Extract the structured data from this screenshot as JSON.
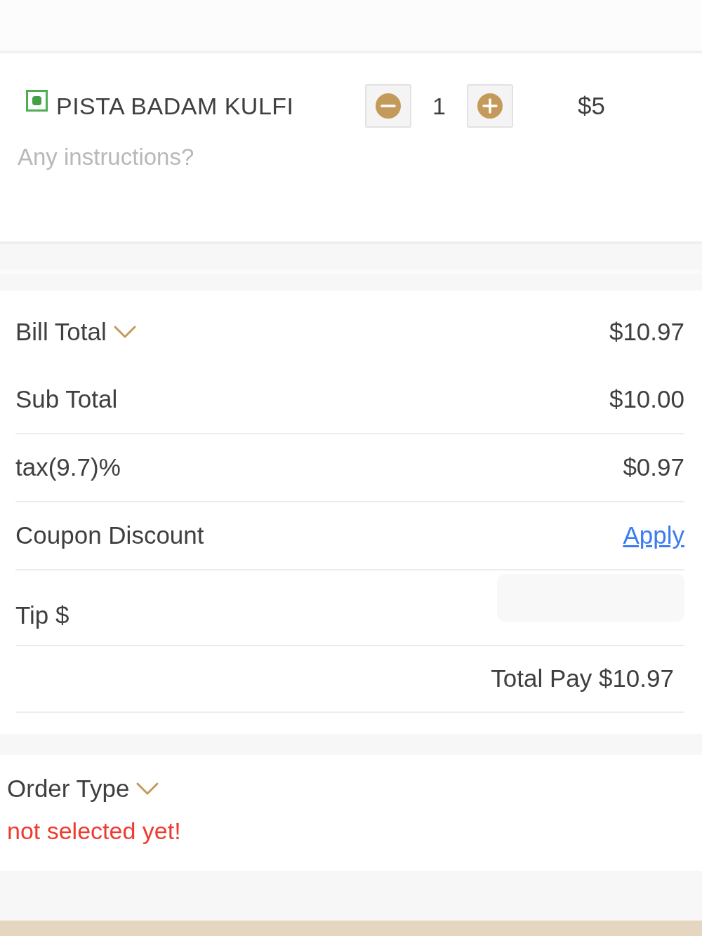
{
  "item": {
    "name": "PISTA BADAM KULFI",
    "quantity": "1",
    "price": "$5",
    "instructions": {
      "placeholder": "Any instructions?"
    }
  },
  "bill": {
    "title": "Bill Total",
    "total": "$10.97",
    "rows": [
      {
        "kind": "amount",
        "label": "Sub Total",
        "value": "$10.00"
      },
      {
        "kind": "amount",
        "label": "tax(9.7)%",
        "value": "$0.97"
      },
      {
        "kind": "link",
        "label": "Coupon Discount",
        "value": "Apply"
      },
      {
        "kind": "input",
        "label": "Tip $"
      }
    ],
    "total_pay": "Total Pay $10.97"
  },
  "order_type": {
    "title": "Order Type",
    "status": "not selected yet!"
  }
}
